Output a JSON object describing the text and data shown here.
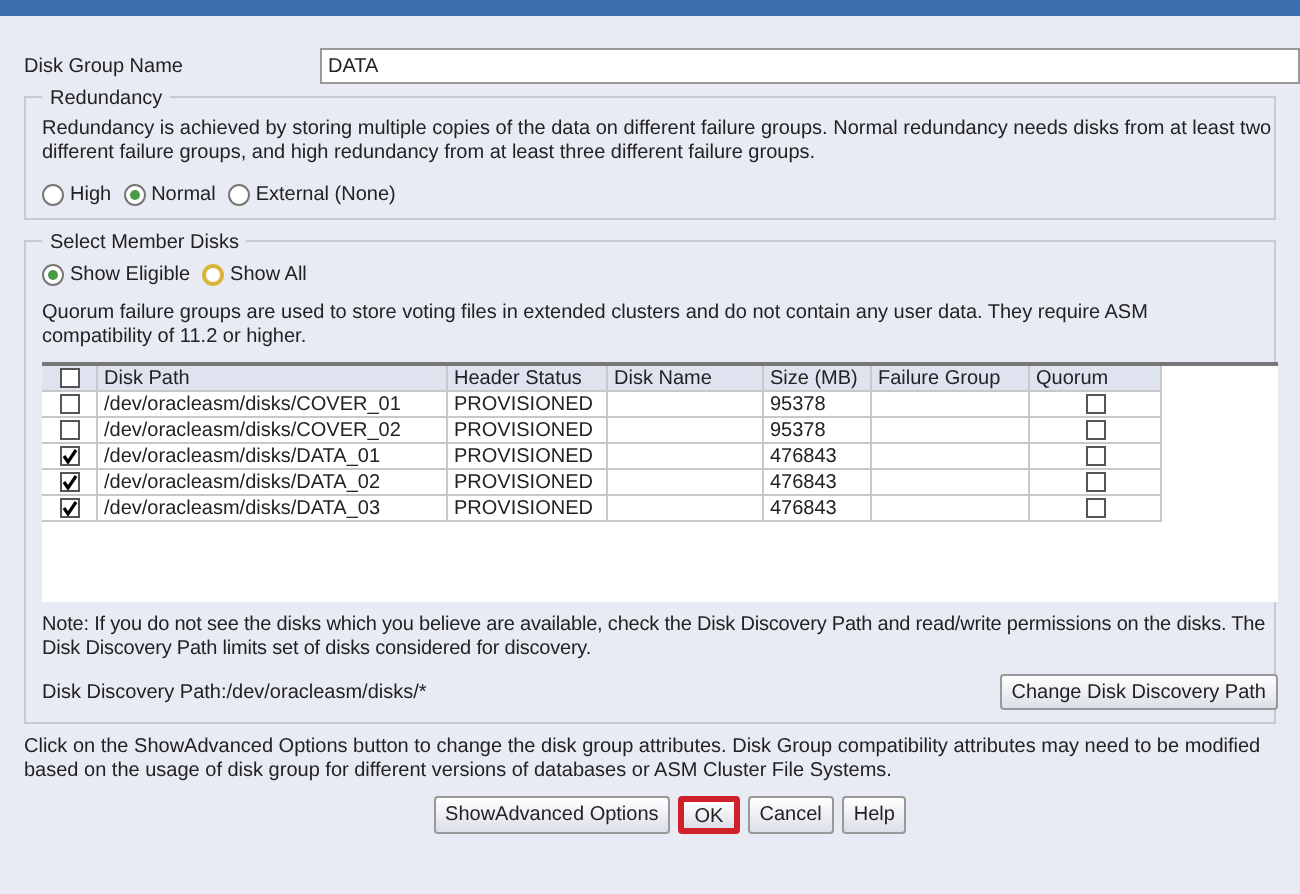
{
  "disk_group_name": {
    "label": "Disk Group Name",
    "value": "DATA"
  },
  "redundancy": {
    "title": "Redundancy",
    "description": "Redundancy is achieved by storing multiple copies of the data on different failure groups. Normal redundancy needs disks from at least two different failure groups, and high redundancy from at least three different failure groups.",
    "options": [
      {
        "label": "High",
        "selected": false
      },
      {
        "label": "Normal",
        "selected": true
      },
      {
        "label": "External (None)",
        "selected": false
      }
    ]
  },
  "member_disks": {
    "title": "Select Member Disks",
    "filters": [
      {
        "label": "Show Eligible",
        "selected": true,
        "hovered": false
      },
      {
        "label": "Show All",
        "selected": false,
        "hovered": true
      }
    ],
    "note_quorum": "Quorum failure groups are used to store voting files in extended clusters and do not contain any user data. They require ASM compatibility of 11.2 or higher.",
    "table": {
      "select_all_checked": false,
      "columns": [
        "Disk Path",
        "Header Status",
        "Disk Name",
        "Size (MB)",
        "Failure Group",
        "Quorum"
      ],
      "rows": [
        {
          "checked": false,
          "path": "/dev/oracleasm/disks/COVER_01",
          "header_status": "PROVISIONED",
          "size": "95378",
          "quorum": false
        },
        {
          "checked": false,
          "path": "/dev/oracleasm/disks/COVER_02",
          "header_status": "PROVISIONED",
          "size": "95378",
          "quorum": false
        },
        {
          "checked": true,
          "path": "/dev/oracleasm/disks/DATA_01",
          "header_status": "PROVISIONED",
          "size": "476843",
          "quorum": false
        },
        {
          "checked": true,
          "path": "/dev/oracleasm/disks/DATA_02",
          "header_status": "PROVISIONED",
          "size": "476843",
          "quorum": false
        },
        {
          "checked": true,
          "path": "/dev/oracleasm/disks/DATA_03",
          "header_status": "PROVISIONED",
          "size": "476843",
          "quorum": false
        }
      ]
    },
    "note_discovery": "Note: If you do not see the disks which you believe are available, check the Disk Discovery Path and read/write permissions on the disks. The Disk Discovery Path limits set of disks considered for discovery.",
    "discovery_path": "Disk Discovery Path:/dev/oracleasm/disks/*",
    "change_button": "Change Disk Discovery Path"
  },
  "advanced_note": "Click on the ShowAdvanced Options button to change the disk group attributes. Disk Group compatibility attributes may need to be modified based on the usage of disk group for different versions of databases or ASM Cluster File Systems.",
  "buttons": [
    {
      "label": "ShowAdvanced Options",
      "highlighted": false
    },
    {
      "label": "OK",
      "highlighted": true
    },
    {
      "label": "Cancel",
      "highlighted": false
    },
    {
      "label": "Help",
      "highlighted": false
    }
  ]
}
